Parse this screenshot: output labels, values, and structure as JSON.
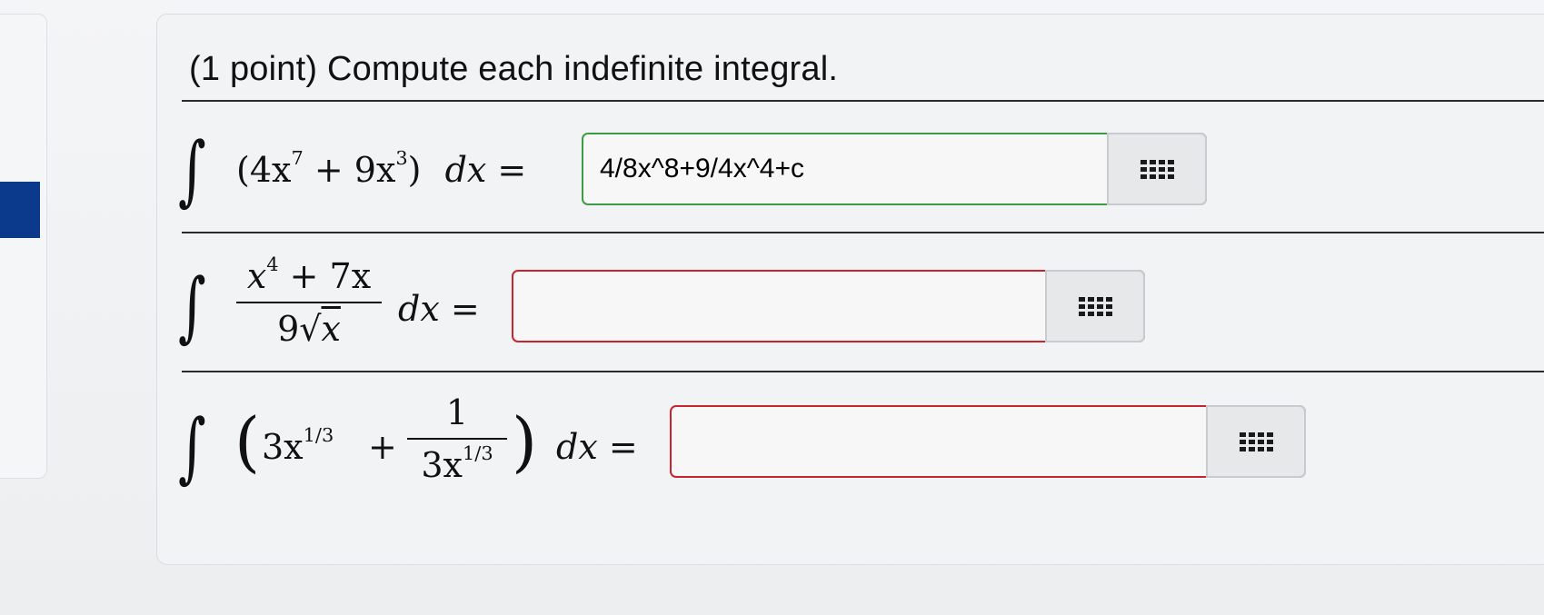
{
  "problem": {
    "title": "(1 point) Compute each indefinite integral."
  },
  "questions": [
    {
      "integral_sign": "∫",
      "lparen": "(",
      "term1_coef": "4x",
      "term1_exp": "7",
      "plus": "+",
      "term2_coef": "9x",
      "term2_exp": "3",
      "rparen": ")",
      "dx": "dx =",
      "answer_value": "4/8x^8+9/4x^4+c",
      "answer_placeholder": "",
      "state": "correct"
    },
    {
      "integral_sign": "∫",
      "num_base": "x",
      "num_exp": "4",
      "num_rest": " + 7x",
      "den_coef": "9",
      "den_radical": "√",
      "den_radicand": "x",
      "dx": "dx =",
      "answer_value": "",
      "answer_placeholder": "",
      "state": "incorrect"
    },
    {
      "integral_sign": "∫",
      "lparen": "(",
      "term1_coef": "3x",
      "term1_exp": "1/3",
      "plus": "+",
      "frac_num": "1",
      "frac_den_coef": "3x",
      "frac_den_exp": "1/3",
      "rparen": ")",
      "dx": "dx =",
      "answer_value": "",
      "answer_placeholder": "",
      "state": "incorrect"
    }
  ],
  "keypad": {
    "icon": "grid-keypad-icon"
  },
  "colors": {
    "correct": "#3e9a45",
    "incorrect": "#c8242f",
    "marker": "#0b3a8c"
  }
}
